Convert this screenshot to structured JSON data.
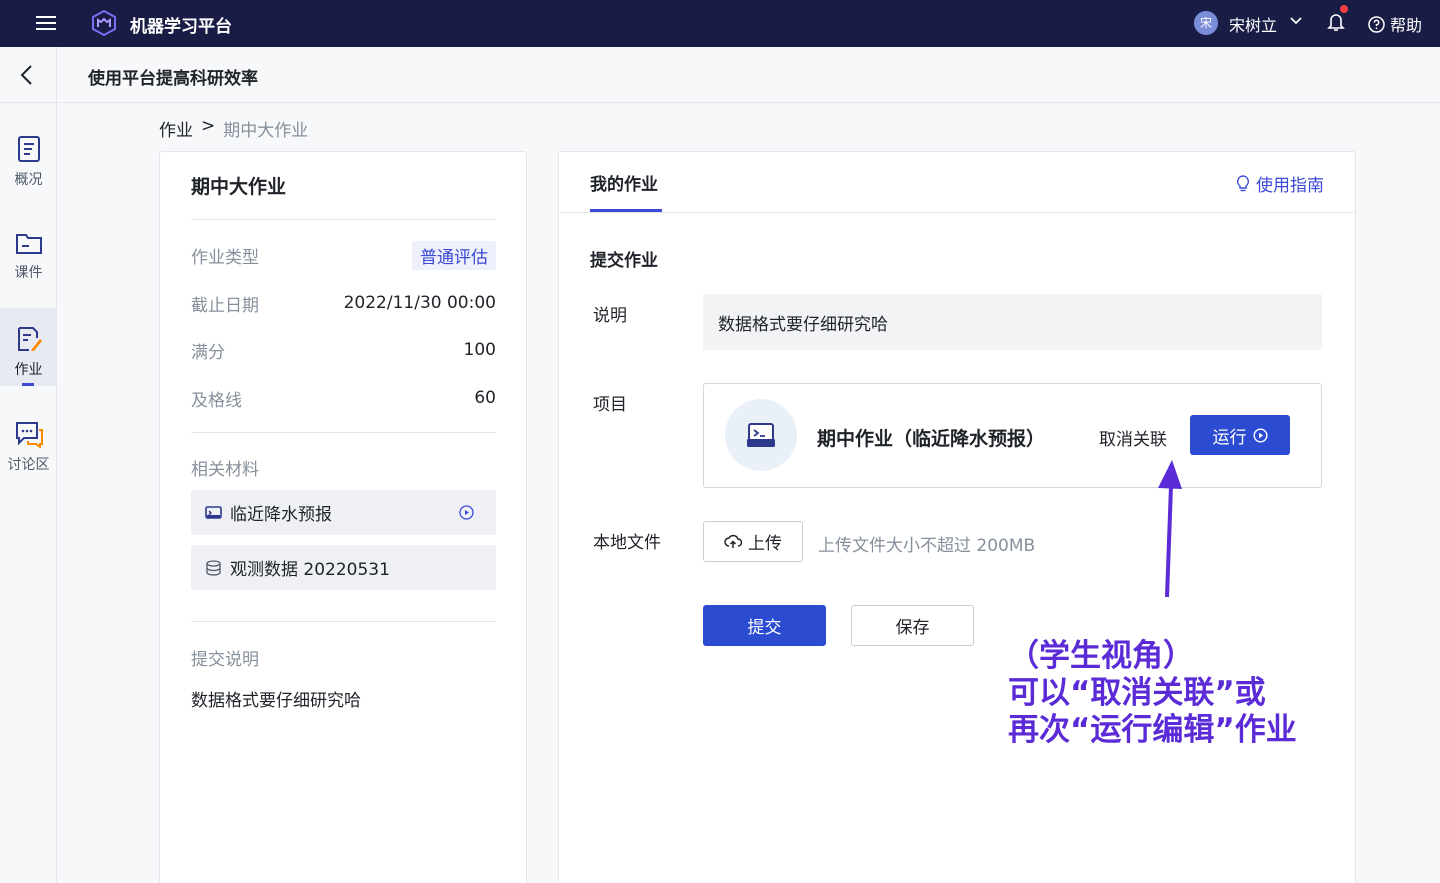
{
  "topbar": {
    "app_title": "机器学习平台",
    "user_avatar_text": "宋",
    "user_name": "宋树立",
    "help_label": "帮助"
  },
  "subheader": {
    "course_title": "使用平台提高科研效率"
  },
  "sidenav": {
    "items": [
      {
        "label": "概况",
        "icon": "overview-icon"
      },
      {
        "label": "课件",
        "icon": "courseware-folder-icon"
      },
      {
        "label": "作业",
        "icon": "homework-edit-icon",
        "active": true
      },
      {
        "label": "讨论区",
        "icon": "discussion-chat-icon"
      }
    ]
  },
  "breadcrumb": {
    "root": "作业",
    "separator": ">",
    "current": "期中大作业"
  },
  "assignment": {
    "title": "期中大作业",
    "type_label": "作业类型",
    "type_value": "普通评估",
    "deadline_label": "截止日期",
    "deadline_value": "2022/11/30 00:00",
    "full_score_label": "满分",
    "full_score_value": "100",
    "pass_line_label": "及格线",
    "pass_line_value": "60",
    "materials_label": "相关材料",
    "materials": [
      {
        "name": "临近降水预报",
        "icon": "project-icon"
      },
      {
        "name": "观测数据 20220531",
        "icon": "database-icon"
      }
    ],
    "submit_desc_label": "提交说明",
    "submit_desc_text": "数据格式要仔细研究哈"
  },
  "my_work": {
    "tab_label": "我的作业",
    "guide_label": "使用指南",
    "form_heading": "提交作业",
    "desc_label": "说明",
    "desc_value": "数据格式要仔细研究哈",
    "project_label": "项目",
    "project_name": "期中作业（临近降水预报）",
    "unlink_label": "取消关联",
    "run_label": "运行",
    "local_file_label": "本地文件",
    "upload_label": "上传",
    "upload_hint": "上传文件大小不超过 200MB",
    "submit_label": "提交",
    "save_label": "保存"
  },
  "annotation": {
    "line1": "（学生视角）",
    "line2": "可以“取消关联”或",
    "line3": "再次“运行编辑”作业",
    "color": "#5a2bd6"
  },
  "colors": {
    "topbar_bg": "#191c45",
    "primary": "#2b4bd1",
    "accent": "#3c49d6",
    "notification_dot": "#f53f3f"
  }
}
